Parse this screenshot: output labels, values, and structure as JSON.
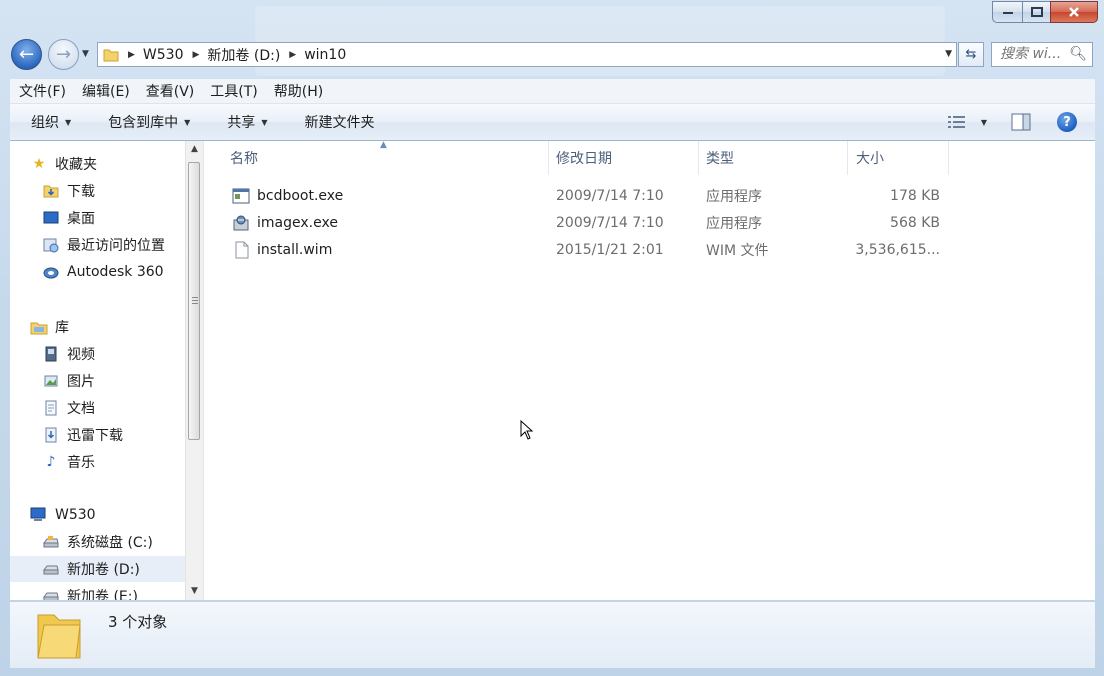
{
  "window": {
    "controls": {
      "minimize_icon": "minimize-icon",
      "maximize_icon": "maximize-icon",
      "close_icon": "close-icon"
    }
  },
  "address_bar": {
    "crumbs": [
      "W530",
      "新加卷 (D:)",
      "win10"
    ]
  },
  "search": {
    "placeholder": "搜索 wi..."
  },
  "menu": {
    "items": [
      "文件(F)",
      "编辑(E)",
      "查看(V)",
      "工具(T)",
      "帮助(H)"
    ]
  },
  "toolbar": {
    "organize": "组织",
    "include_in_library": "包含到库中",
    "share": "共享",
    "new_folder": "新建文件夹"
  },
  "navigation": {
    "favorites": {
      "label": "收藏夹",
      "items": [
        "下载",
        "桌面",
        "最近访问的位置",
        "Autodesk 360"
      ]
    },
    "libraries": {
      "label": "库",
      "items": [
        "视频",
        "图片",
        "文档",
        "迅雷下载",
        "音乐"
      ]
    },
    "computer": {
      "label": "W530",
      "items": [
        "系统磁盘 (C:)",
        "新加卷 (D:)",
        "新加卷 (E:)"
      ],
      "selected": "新加卷 (D:)"
    }
  },
  "file_list": {
    "columns": [
      "名称",
      "修改日期",
      "类型",
      "大小"
    ],
    "files": [
      {
        "name": "bcdboot.exe",
        "modified": "2009/7/14 7:10",
        "type": "应用程序",
        "size": "178 KB",
        "icon": "exe-window-icon"
      },
      {
        "name": "imagex.exe",
        "modified": "2009/7/14 7:10",
        "type": "应用程序",
        "size": "568 KB",
        "icon": "exe-setup-icon"
      },
      {
        "name": "install.wim",
        "modified": "2015/1/21 2:01",
        "type": "WIM 文件",
        "size": "3,536,615...",
        "icon": "blank-file-icon"
      }
    ]
  },
  "details_pane": {
    "item_count": "3 个对象"
  },
  "colors": {
    "accent": "#2d68c0",
    "selection": "#e7eef7",
    "chrome": "#c6d9ec"
  }
}
